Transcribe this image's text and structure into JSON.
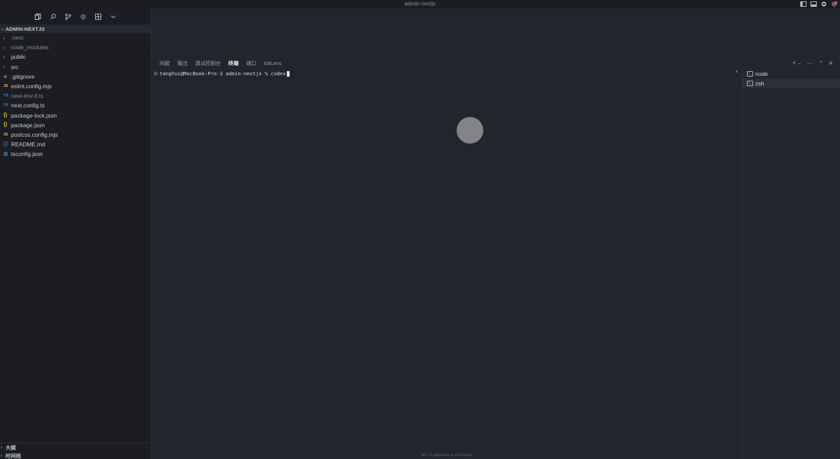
{
  "window": {
    "title": "admin-nextjs"
  },
  "sidebar": {
    "activity_icons": [
      "files-icon",
      "search-icon",
      "source-control-icon",
      "extensions-icon",
      "layout-icon",
      "chevron-down-icon"
    ],
    "explorer_title": "ADMIN-NEXTJS",
    "tree": [
      {
        "label": ".next",
        "icon": "chevron-right",
        "dim": true
      },
      {
        "label": "node_modules",
        "icon": "chevron-right",
        "dim": true
      },
      {
        "label": "public",
        "icon": "chevron-right",
        "dim": false
      },
      {
        "label": "src",
        "icon": "chevron-right",
        "dim": false
      },
      {
        "label": ".gitignore",
        "icon": "git",
        "dim": false
      },
      {
        "label": "eslint.config.mjs",
        "icon": "JS",
        "dim": false
      },
      {
        "label": "next-env.d.ts",
        "icon": "TS",
        "dim": true
      },
      {
        "label": "next.config.ts",
        "icon": "TS",
        "dim": false
      },
      {
        "label": "package-lock.json",
        "icon": "{}",
        "dim": false
      },
      {
        "label": "package.json",
        "icon": "{}",
        "dim": false
      },
      {
        "label": "postcss.config.mjs",
        "icon": "JS",
        "dim": false
      },
      {
        "label": "README.md",
        "icon": "info",
        "dim": false
      },
      {
        "label": "tsconfig.json",
        "icon": "tsconfig",
        "dim": false
      }
    ],
    "bottom": {
      "outline": "大纲",
      "timeline": "时间线"
    }
  },
  "panel": {
    "tabs": [
      {
        "label": "问题",
        "active": false
      },
      {
        "label": "输出",
        "active": false
      },
      {
        "label": "调试控制台",
        "active": false
      },
      {
        "label": "终端",
        "active": true
      },
      {
        "label": "端口",
        "active": false
      },
      {
        "label": "GitLens",
        "active": false
      }
    ],
    "terminal_prompt": "tanghui@MacBook-Pro-3 admin-nextjs % codex",
    "terminals": [
      {
        "label": "node",
        "selected": false
      },
      {
        "label": "zsh",
        "selected": true
      }
    ],
    "hint": "⌘K to generate a command"
  }
}
